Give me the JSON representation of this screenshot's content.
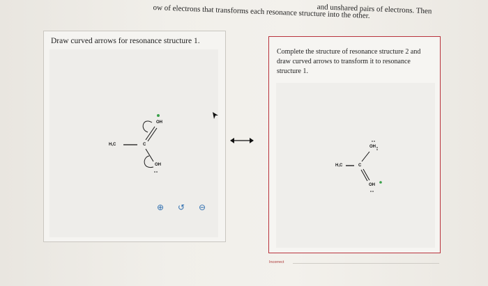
{
  "instructions": {
    "line1": "and unshared pairs of electrons. Then",
    "line2": "ow of electrons that transforms each resonance structure into the other."
  },
  "left_panel": {
    "title": "Draw curved arrows for resonance structure 1.",
    "atoms": {
      "methyl": "H,C",
      "carbon": "C",
      "oh_top": "OH",
      "oh_bottom": "OH"
    },
    "toolbar": {
      "zoom_in": "⊕",
      "reset": "↺",
      "zoom_out": "⊖"
    }
  },
  "right_panel": {
    "title": "Complete the structure of resonance structure 2 and draw curved arrows to transform it to resonance structure 1.",
    "atoms": {
      "methyl": "H,C",
      "carbon": "C",
      "oh_top": "OH",
      "oh_bottom": "OH"
    }
  },
  "status": {
    "text": "Incorrect"
  },
  "colors": {
    "error_border": "#b8323c",
    "icon_blue": "#2f6fb0",
    "charge_green": "#3aa04a"
  }
}
